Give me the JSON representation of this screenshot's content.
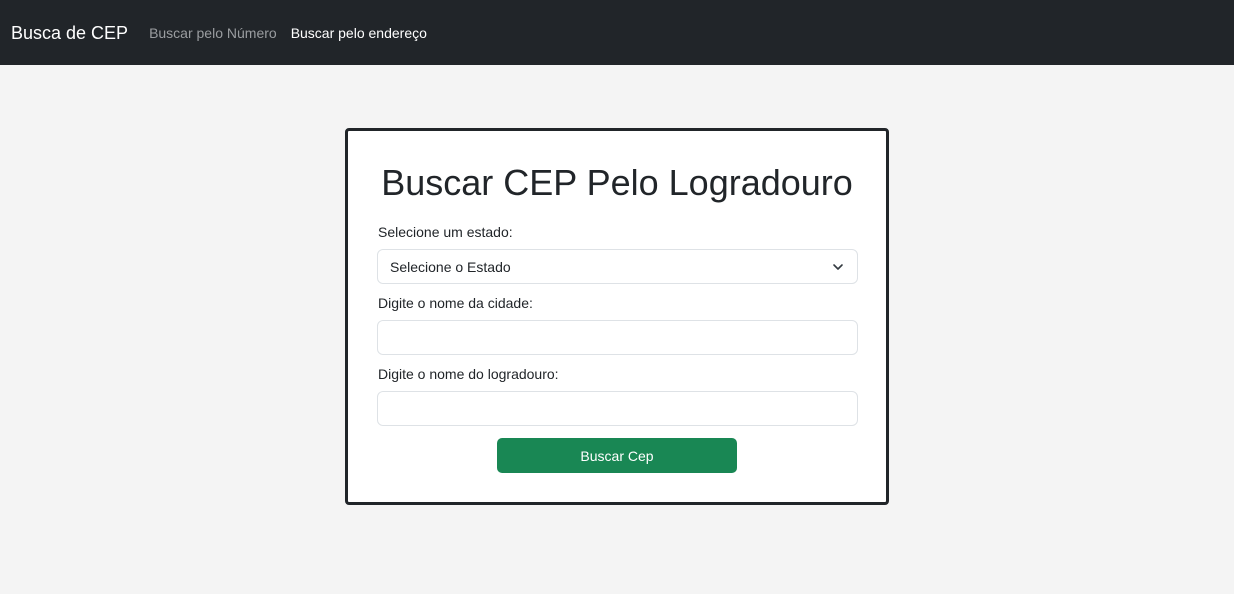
{
  "navbar": {
    "brand": "Busca de CEP",
    "links": [
      {
        "label": "Buscar pelo Número",
        "active": false
      },
      {
        "label": "Buscar pelo endereço",
        "active": true
      }
    ]
  },
  "form": {
    "title": "Buscar CEP Pelo Logradouro",
    "state_label": "Selecione um estado:",
    "state_selected": "Selecione o Estado",
    "city_label": "Digite o nome da cidade:",
    "city_value": "",
    "street_label": "Digite o nome do logradouro:",
    "street_value": "",
    "submit_label": "Buscar Cep"
  },
  "colors": {
    "navbar_bg": "#212529",
    "page_bg": "#f4f4f4",
    "button_bg": "#198754"
  },
  "icons": {
    "select_arrow": "chevron-down-icon"
  }
}
